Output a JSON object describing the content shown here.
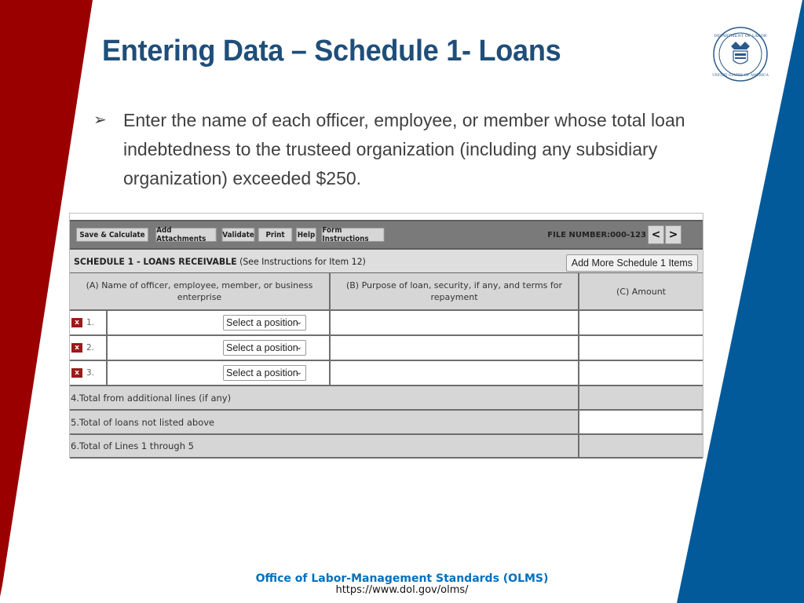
{
  "slide": {
    "title": "Entering Data – Schedule 1- Loans",
    "bullet_glyph": "➢",
    "bullet_text": "Enter the name of each officer, employee, or member whose total loan indebtedness to the trusteed organization (including any subsidiary organization) exceeded $250.",
    "seal_label": "Department of Labor seal",
    "colors": {
      "title": "#1f4e79",
      "red_band": "#9b0000",
      "blue_band": "#035a9a",
      "footer": "#0070c0"
    }
  },
  "form": {
    "toolbar": {
      "buttons": [
        "Save & Calculate",
        "Add Attachments",
        "Validate",
        "Print",
        "Help",
        "Form Instructions"
      ],
      "file_number": "FILE NUMBER:000-123",
      "prev_label": "<",
      "next_label": ">"
    },
    "schedule": {
      "title_bold": "SCHEDULE 1 - LOANS RECEIVABLE",
      "title_note": " (See Instructions for Item 12)",
      "add_more_label": "Add More Schedule 1 Items"
    },
    "columns": [
      "(A) Name of officer, employee, member, or business enterprise",
      "(B) Purpose of loan, security, if any, and terms for repayment",
      "(C) Amount"
    ],
    "entry_rows": [
      {
        "delete": "x",
        "num": "1.",
        "name": "",
        "position": "Select a position",
        "purpose": "",
        "amount": ""
      },
      {
        "delete": "x",
        "num": "2.",
        "name": "",
        "position": "Select a position",
        "purpose": "",
        "amount": ""
      },
      {
        "delete": "x",
        "num": "3.",
        "name": "",
        "position": "Select a position",
        "purpose": "",
        "amount": ""
      }
    ],
    "total_rows": [
      {
        "label": "4.Total from additional lines (if any)",
        "amount": ""
      },
      {
        "label": "5.Total of loans not listed above",
        "amount": ""
      },
      {
        "label": "6.Total of Lines 1 through 5",
        "amount": ""
      }
    ]
  },
  "footer": {
    "org": "Office of Labor-Management Standards (OLMS)",
    "url": "https://www.dol.gov/olms/"
  }
}
